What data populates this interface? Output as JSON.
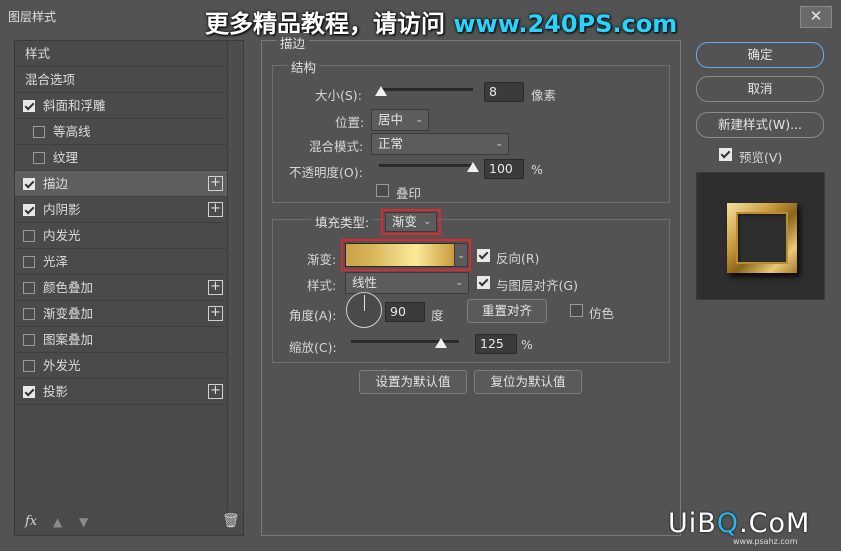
{
  "window": {
    "title": "图层样式",
    "close_glyph": "✕"
  },
  "watermark": {
    "text": "更多精品教程，请访问 ",
    "url": "www.240PS.com"
  },
  "left_panel": {
    "items": [
      {
        "label": "样式",
        "checkbox": false,
        "checked": false,
        "plus": false,
        "indent": false,
        "active": false
      },
      {
        "label": "混合选项",
        "checkbox": false,
        "checked": false,
        "plus": false,
        "indent": false,
        "active": false
      },
      {
        "label": "斜面和浮雕",
        "checkbox": true,
        "checked": true,
        "plus": false,
        "indent": false,
        "active": false
      },
      {
        "label": "等高线",
        "checkbox": true,
        "checked": false,
        "plus": false,
        "indent": true,
        "active": false
      },
      {
        "label": "纹理",
        "checkbox": true,
        "checked": false,
        "plus": false,
        "indent": true,
        "active": false
      },
      {
        "label": "描边",
        "checkbox": true,
        "checked": true,
        "plus": true,
        "indent": false,
        "active": true
      },
      {
        "label": "内阴影",
        "checkbox": true,
        "checked": true,
        "plus": true,
        "indent": false,
        "active": false
      },
      {
        "label": "内发光",
        "checkbox": true,
        "checked": false,
        "plus": false,
        "indent": false,
        "active": false
      },
      {
        "label": "光泽",
        "checkbox": true,
        "checked": false,
        "plus": false,
        "indent": false,
        "active": false
      },
      {
        "label": "颜色叠加",
        "checkbox": true,
        "checked": false,
        "plus": true,
        "indent": false,
        "active": false
      },
      {
        "label": "渐变叠加",
        "checkbox": true,
        "checked": false,
        "plus": true,
        "indent": false,
        "active": false
      },
      {
        "label": "图案叠加",
        "checkbox": true,
        "checked": false,
        "plus": false,
        "indent": false,
        "active": false
      },
      {
        "label": "外发光",
        "checkbox": true,
        "checked": false,
        "plus": false,
        "indent": false,
        "active": false
      },
      {
        "label": "投影",
        "checkbox": true,
        "checked": true,
        "plus": true,
        "indent": false,
        "active": false
      }
    ],
    "plus_glyph": "+",
    "footer": {
      "fx": "fx",
      "up": "▲",
      "down": "▼",
      "trash": "🗑"
    }
  },
  "stroke": {
    "section_title": "描边",
    "structure_title": "结构",
    "size_label": "大小(S):",
    "size_value": "8",
    "size_unit": "像素",
    "size_fraction": 0.02,
    "position_label": "位置:",
    "position_value": "居中",
    "blend_label": "混合模式:",
    "blend_value": "正常",
    "opacity_label": "不透明度(O):",
    "opacity_value": "100",
    "opacity_unit": "%",
    "opacity_fraction": 1.0,
    "overprint_label": "叠印",
    "overprint_checked": false,
    "fill_type_label": "填充类型:",
    "fill_type_value": "渐变",
    "gradient_label": "渐变:",
    "reverse_label": "反向(R)",
    "reverse_checked": true,
    "style_label": "样式:",
    "style_value": "线性",
    "align_label": "与图层对齐(G)",
    "align_checked": true,
    "angle_label": "角度(A):",
    "angle_value": "90",
    "angle_unit": "度",
    "reset_align_label": "重置对齐",
    "dither_label": "仿色",
    "dither_checked": false,
    "scale_label": "缩放(C):",
    "scale_value": "125",
    "scale_unit": "%",
    "scale_fraction": 0.83,
    "set_default_label": "设置为默认值",
    "reset_default_label": "复位为默认值",
    "chevron": "⌄"
  },
  "right": {
    "ok_label": "确定",
    "cancel_label": "取消",
    "new_style_label": "新建样式(W)...",
    "preview_label": "预览(V)",
    "preview_checked": true
  },
  "corner_watermark": {
    "pre": "UiB",
    "o": "Q",
    "post": ".CoM",
    "sub": "www.psahz.com"
  }
}
